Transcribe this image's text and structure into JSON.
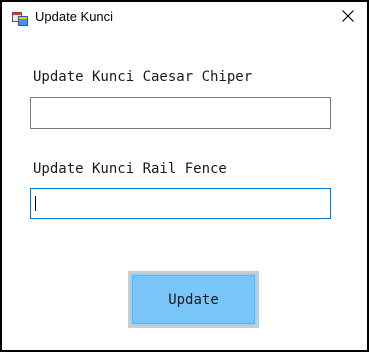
{
  "window": {
    "title": "Update Kunci",
    "icon": "form-icon",
    "close_icon": "close-icon"
  },
  "form": {
    "caesar_label": "Update Kunci Caesar Chiper",
    "caesar_value": "",
    "railfence_label": "Update Kunci Rail Fence",
    "railfence_value": "",
    "update_label": "Update"
  },
  "colors": {
    "button_fill": "#79c5fa",
    "focus_border": "#0078d7"
  }
}
